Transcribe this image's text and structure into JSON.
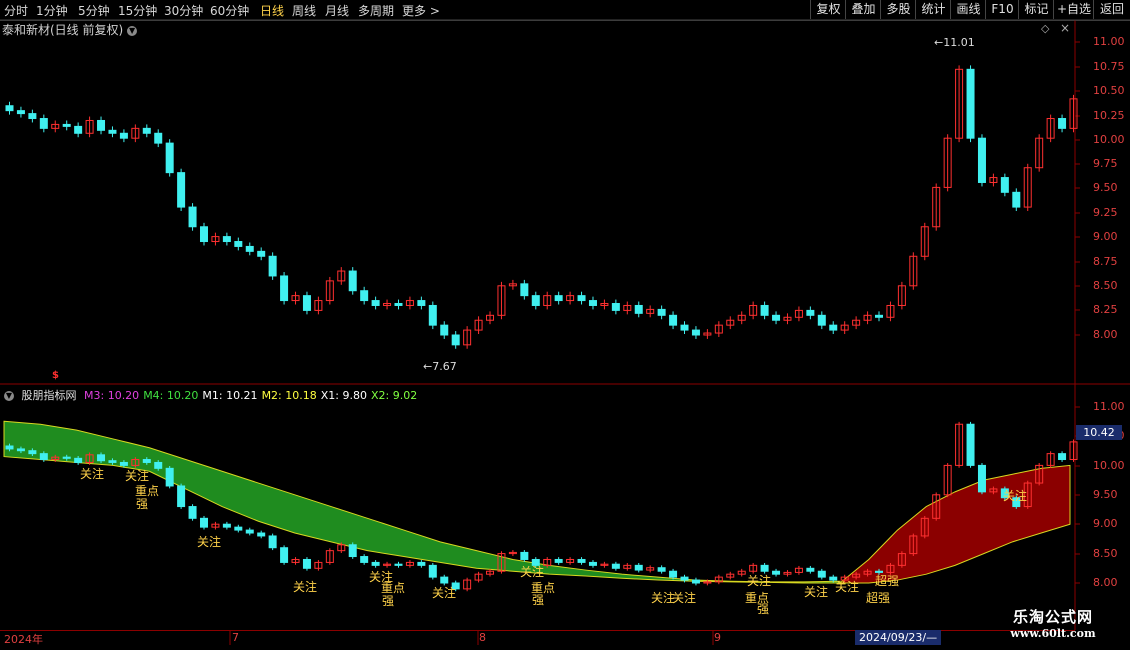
{
  "periods": [
    "分时",
    "1分钟",
    "5分钟",
    "15分钟",
    "30分钟",
    "60分钟",
    "日线",
    "周线",
    "月线",
    "多周期",
    "更多 >"
  ],
  "active_period": "日线",
  "toolbar": [
    "复权",
    "叠加",
    "多股",
    "统计",
    "画线",
    "F10",
    "标记",
    "+自选",
    "返回"
  ],
  "stock_title": "泰和新材(日线 前复权)",
  "price_marks": {
    "high": "11.01",
    "low": "7.67"
  },
  "indicator": {
    "name": "股朋指标网",
    "values": [
      {
        "label": "M3: 10.20",
        "color": "#e040e0"
      },
      {
        "label": "M4: 10.20",
        "color": "#40e040"
      },
      {
        "label": "M1: 10.21",
        "color": "#ffffff"
      },
      {
        "label": "M2: 10.18",
        "color": "#ffff40"
      },
      {
        "label": "X1: 9.80",
        "color": "#ffffff"
      },
      {
        "label": "X2: 9.02",
        "color": "#80ff40"
      }
    ]
  },
  "axis_top": [
    "11.00",
    "10.75",
    "10.50",
    "10.25",
    "10.00",
    "9.75",
    "9.50",
    "9.25",
    "9.00",
    "8.75",
    "8.50",
    "8.25",
    "8.00"
  ],
  "axis_bottom": [
    "11.00",
    "10.50",
    "10.00",
    "9.50",
    "9.00",
    "8.50",
    "8.00"
  ],
  "current_price": "10.42",
  "dates": [
    "2024年",
    "7",
    "8",
    "9"
  ],
  "date_highlight": "2024/09/23/—",
  "signal_labels": [
    "关注",
    "重点",
    "强",
    "超强"
  ],
  "watermark": {
    "line1": "乐淘公式网",
    "line2": "www.60lt.com"
  },
  "colors": {
    "up": "#ff3030",
    "down": "#40f0f0",
    "green_band": "#1f8c1f",
    "red_band": "#8b0000",
    "label": "#ffd24a"
  }
}
